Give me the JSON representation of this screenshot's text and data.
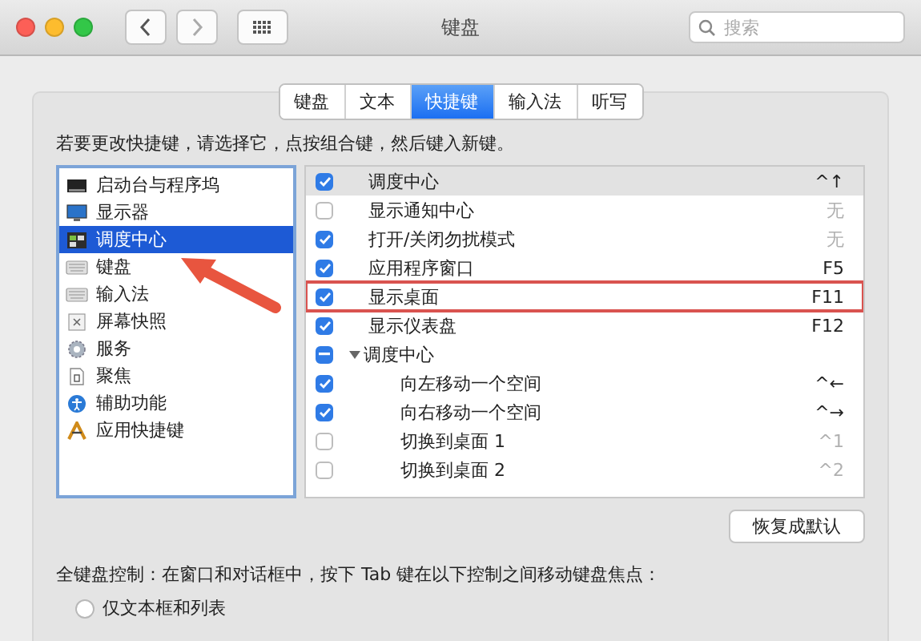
{
  "window": {
    "title": "键盘",
    "search_placeholder": "搜索"
  },
  "tabs": [
    {
      "label": "键盘",
      "selected": false
    },
    {
      "label": "文本",
      "selected": false
    },
    {
      "label": "快捷键",
      "selected": true
    },
    {
      "label": "输入法",
      "selected": false
    },
    {
      "label": "听写",
      "selected": false
    }
  ],
  "instruction": "若要更改快捷键，请选择它，点按组合键，然后键入新键。",
  "categories": [
    {
      "label": "启动台与程序坞",
      "selected": false
    },
    {
      "label": "显示器",
      "selected": false
    },
    {
      "label": "调度中心",
      "selected": true
    },
    {
      "label": "键盘",
      "selected": false
    },
    {
      "label": "输入法",
      "selected": false
    },
    {
      "label": "屏幕快照",
      "selected": false
    },
    {
      "label": "服务",
      "selected": false
    },
    {
      "label": "聚焦",
      "selected": false
    },
    {
      "label": "辅助功能",
      "selected": false
    },
    {
      "label": "应用快捷键",
      "selected": false
    }
  ],
  "shortcuts": [
    {
      "kind": "item",
      "label": "调度中心",
      "checked": true,
      "key": "^↑",
      "key_disabled": false,
      "selected": true,
      "highlighted": false
    },
    {
      "kind": "item",
      "label": "显示通知中心",
      "checked": false,
      "key": "无",
      "key_disabled": true,
      "selected": false,
      "highlighted": false
    },
    {
      "kind": "item",
      "label": "打开/关闭勿扰模式",
      "checked": true,
      "key": "无",
      "key_disabled": true,
      "selected": false,
      "highlighted": false
    },
    {
      "kind": "item",
      "label": "应用程序窗口",
      "checked": true,
      "key": "F5",
      "key_disabled": false,
      "selected": false,
      "highlighted": false
    },
    {
      "kind": "item",
      "label": "显示桌面",
      "checked": true,
      "key": "F11",
      "key_disabled": false,
      "selected": false,
      "highlighted": true
    },
    {
      "kind": "item",
      "label": "显示仪表盘",
      "checked": true,
      "key": "F12",
      "key_disabled": false,
      "selected": false,
      "highlighted": false
    },
    {
      "kind": "group",
      "label": "调度中心",
      "mixed": true,
      "expanded": true,
      "selected": false,
      "highlighted": false,
      "children": [
        {
          "kind": "item",
          "label": "向左移动一个空间",
          "checked": true,
          "key": "^←",
          "key_disabled": false,
          "selected": false,
          "highlighted": false
        },
        {
          "kind": "item",
          "label": "向右移动一个空间",
          "checked": true,
          "key": "^→",
          "key_disabled": false,
          "selected": false,
          "highlighted": false
        },
        {
          "kind": "item",
          "label": "切换到桌面 1",
          "checked": false,
          "key": "^1",
          "key_disabled": true,
          "selected": false,
          "highlighted": false
        },
        {
          "kind": "item",
          "label": "切换到桌面 2",
          "checked": false,
          "key": "^2",
          "key_disabled": true,
          "selected": false,
          "highlighted": false
        }
      ]
    }
  ],
  "restore_button": "恢复成默认",
  "full_keyboard_text": "全键盘控制：在窗口和对话框中，按下 Tab 键在以下控制之间移动键盘焦点：",
  "focus_options": [
    {
      "label": "仅文本框和列表",
      "selected": false
    }
  ]
}
